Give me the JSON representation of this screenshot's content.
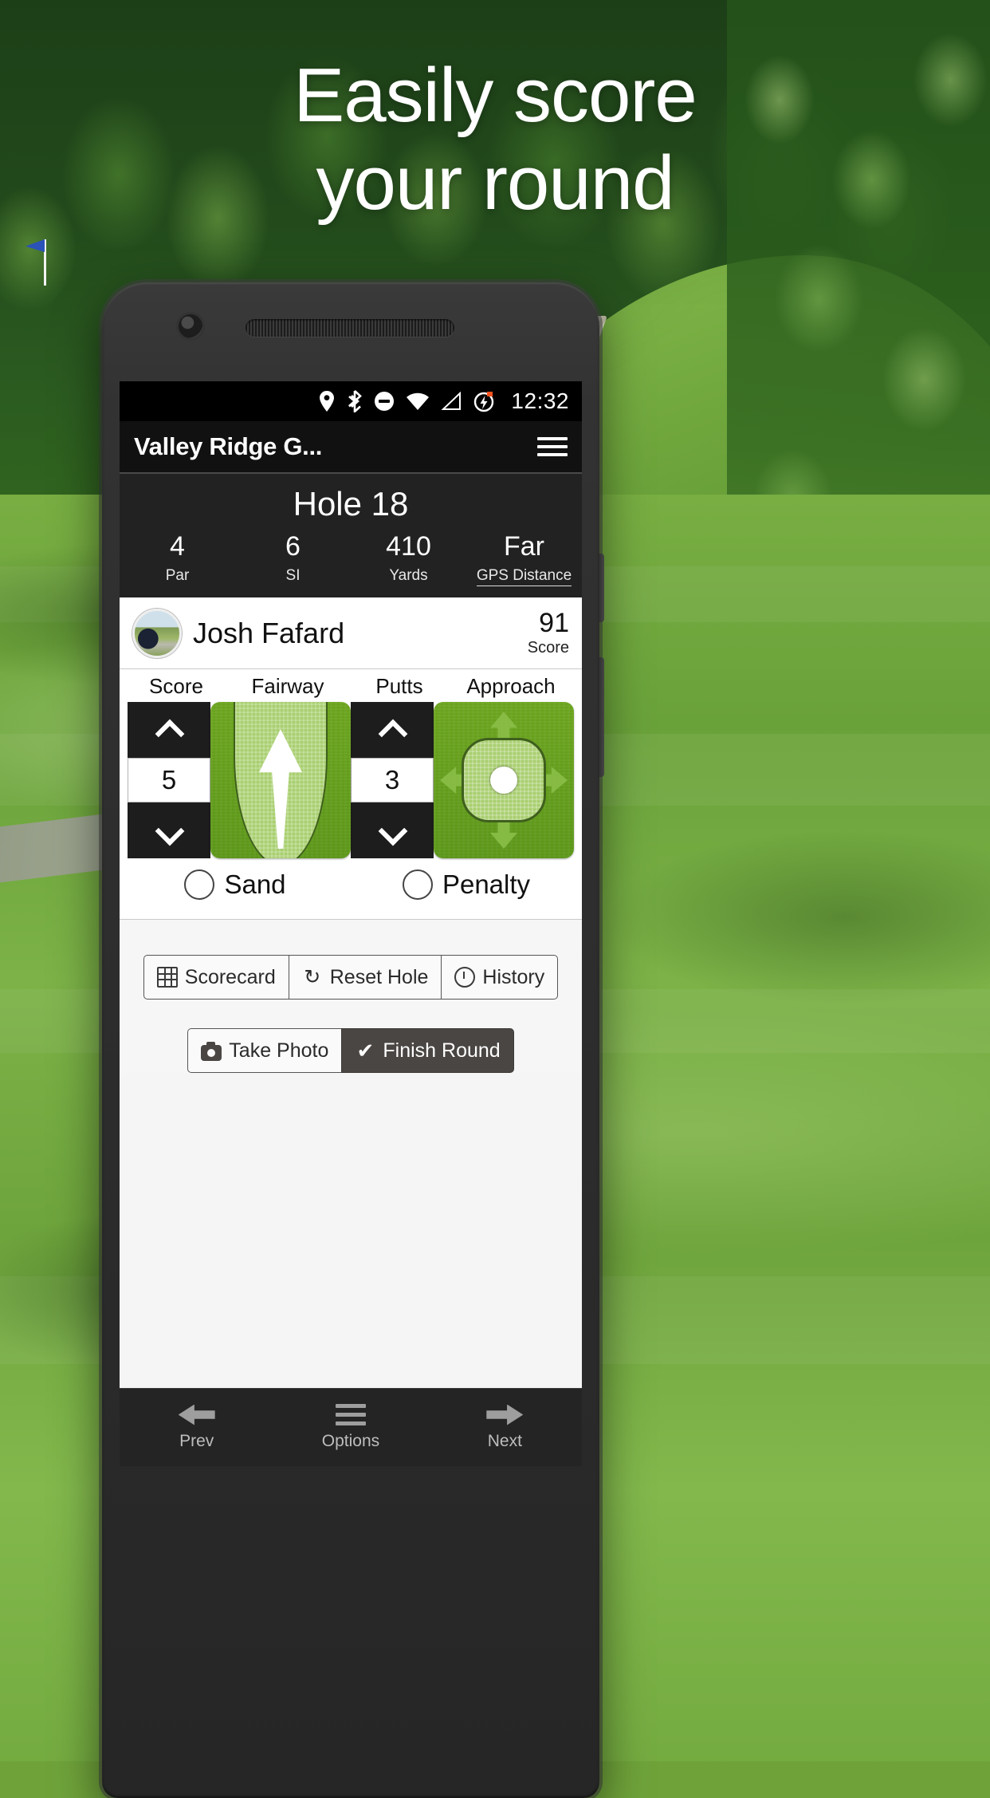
{
  "promo": {
    "headline_line1": "Easily score",
    "headline_line2": "your round"
  },
  "status_bar": {
    "time": "12:32",
    "icons": [
      "location-icon",
      "bluetooth-icon",
      "do-not-disturb-icon",
      "wifi-icon",
      "cell-signal-icon",
      "battery-charging-icon"
    ]
  },
  "app_bar": {
    "title": "Valley Ridge G...",
    "menu_icon": "hamburger-menu-icon"
  },
  "hole": {
    "title": "Hole 18",
    "stats": [
      {
        "value": "4",
        "label": "Par"
      },
      {
        "value": "6",
        "label": "SI"
      },
      {
        "value": "410",
        "label": "Yards"
      },
      {
        "value": "Far",
        "label": "GPS Distance"
      }
    ]
  },
  "player": {
    "name": "Josh Fafard",
    "score_value": "91",
    "score_label": "Score"
  },
  "inputs": {
    "headers": {
      "score": "Score",
      "fairway": "Fairway",
      "putts": "Putts",
      "approach": "Approach"
    },
    "score_value": "5",
    "putts_value": "3",
    "fairway_state": "hit-center",
    "approach_state": "on-green",
    "sand_label": "Sand",
    "penalty_label": "Penalty",
    "sand_checked": "false",
    "penalty_checked": "false"
  },
  "actions": {
    "scorecard": "Scorecard",
    "reset_hole": "Reset Hole",
    "history": "History",
    "take_photo": "Take Photo",
    "finish_round": "Finish Round"
  },
  "bottom_nav": [
    {
      "label": "Prev",
      "icon": "arrow-left-icon"
    },
    {
      "label": "Options",
      "icon": "hamburger-menu-icon"
    },
    {
      "label": "Next",
      "icon": "arrow-right-icon"
    }
  ],
  "colors": {
    "grass_green": "#6fa821",
    "light_green": "#a9cf70",
    "app_dark": "#111111",
    "finish_button": "#4a4643"
  }
}
